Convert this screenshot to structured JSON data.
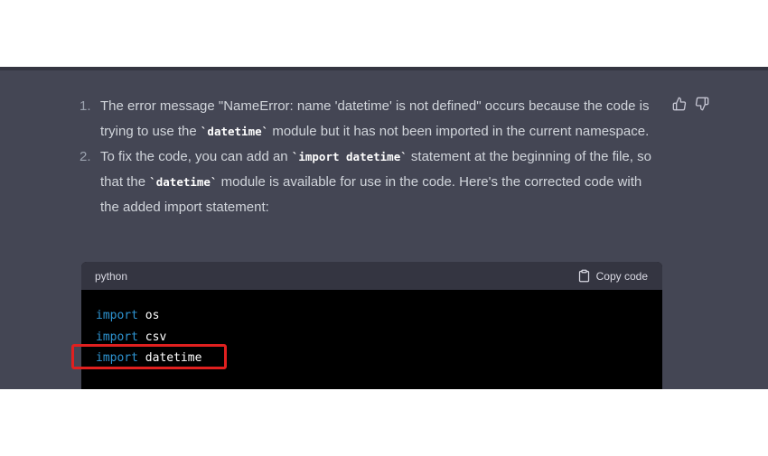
{
  "answer": {
    "items": [
      {
        "number": "1.",
        "parts": [
          "The error message \"NameError: name 'datetime' is not defined\" occurs because the code is trying to use the ",
          "`datetime`",
          " module but it has not been imported in the current namespace."
        ]
      },
      {
        "number": "2.",
        "parts": [
          "To fix the code, you can add an ",
          "`import datetime`",
          " statement at the beginning of the file, so that the ",
          "`datetime`",
          " module is available for use in the code. Here's the corrected code with the added import statement:"
        ]
      }
    ]
  },
  "feedback": {
    "thumbs_up_icon": "thumbs-up-icon",
    "thumbs_down_icon": "thumbs-down-icon"
  },
  "code_block": {
    "language": "python",
    "copy_label": "Copy code",
    "copy_icon": "clipboard-icon",
    "lines": [
      {
        "keyword": "import",
        "module": "os"
      },
      {
        "keyword": "import",
        "module": "csv"
      },
      {
        "keyword": "import",
        "module": "datetime"
      }
    ]
  },
  "colors": {
    "panel_background": "#444654",
    "code_background": "#000000",
    "code_header_background": "#343541",
    "keyword": "#2e95d3",
    "highlight": "#e0201f"
  }
}
